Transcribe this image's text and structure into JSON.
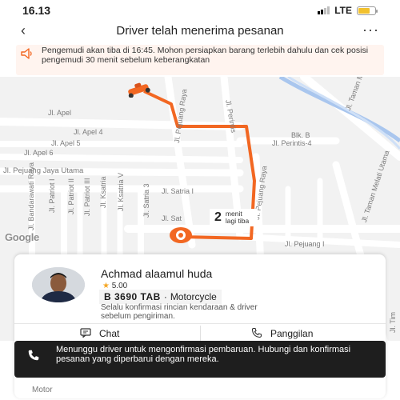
{
  "status_bar": {
    "time": "16.13",
    "network": "LTE"
  },
  "header": {
    "back_icon": "chevron-left-icon",
    "title": "Driver telah menerima pesanan",
    "more_icon": "ellipsis-icon"
  },
  "notice": {
    "icon": "megaphone-icon",
    "text": "Pengemudi akan tiba di 16:45. Mohon persiapkan barang terlebih dahulu dan cek posisi pengemudi 30 menit sebelum keberangkatan"
  },
  "map": {
    "streets": {
      "apel": "Jl. Apel",
      "apel4": "Jl. Apel 4",
      "apel5": "Jl. Apel 5",
      "apel6": "Jl. Apel 6",
      "pejuang_jaya": "Jl. Pejuang Jaya Utama",
      "bandarawati": "Jl. Bandarawati Raya",
      "patriot1": "Jl. Patriot I",
      "patriot2": "Jl. Patriot II",
      "patriot3": "Jl. Patriot III",
      "ksatria": "Jl. Ksatria",
      "ksatria5": "Jl. Ksatria V",
      "satria3": "Jl. Satria 3",
      "satria1": "Jl. Satria I",
      "satria_short": "Jl. Sat",
      "pejuang_raya": "Jl. Pejuang Raya",
      "perintis": "Jl. Perintis",
      "perintis4": "Jl. Perintis-4",
      "blk_b": "Blk. B",
      "taman_melati": "Jl. Taman Melati Utama",
      "taman_melati2": "Jl. Taman Melati Utama",
      "pejuang1": "Jl. Pejuang I",
      "timor": "Jl. Tim"
    },
    "provider_logo": "Google",
    "eta": {
      "value": "2",
      "unit": "menit lagi tiba"
    },
    "route_color": "#f26722"
  },
  "driver": {
    "name": "Achmad alaamul huda",
    "rating": "5.00",
    "plate": "B 3690 TAB",
    "vehicle": "Motorcycle",
    "confirm_note": "Selalu konfirmasi rincian kendaraan & driver sebelum pengiriman."
  },
  "actions": {
    "chat_label": "Chat",
    "call_label": "Panggilan"
  },
  "toast": {
    "icon": "phone-icon",
    "text": "Menunggu driver untuk mengonfirmasi pembaruan. Hubungi dan konfirmasi pesanan yang diperbarui dengan mereka."
  },
  "footer": {
    "label": "Motor"
  },
  "colors": {
    "accent": "#f26722",
    "toast_bg": "#1e1e1e",
    "notice_bg": "#fff4ef",
    "rating_star": "#f5a623"
  }
}
